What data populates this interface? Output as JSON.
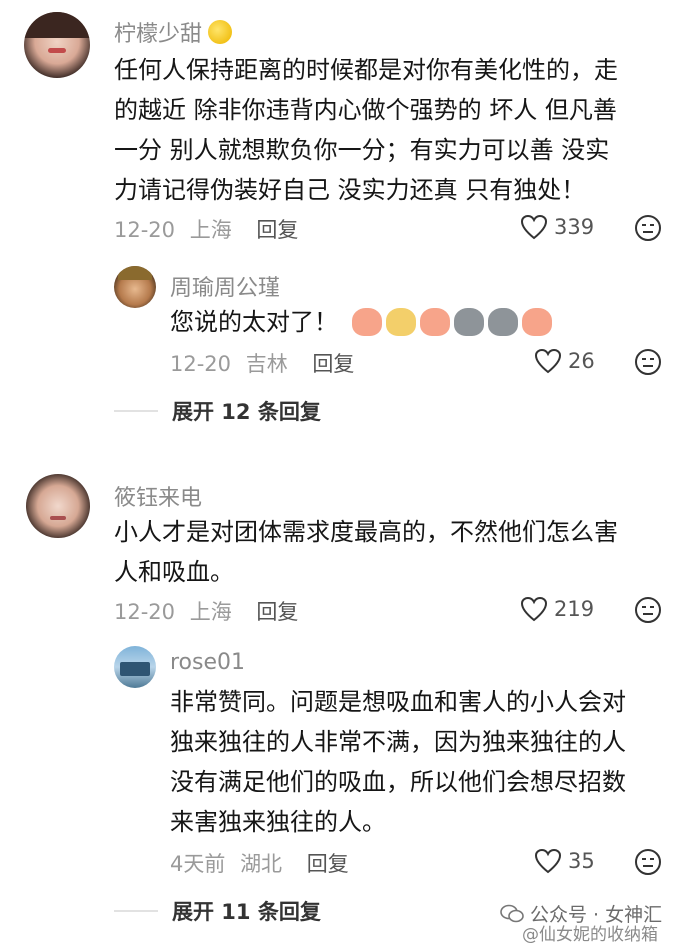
{
  "comments": [
    {
      "username": "柠檬少甜",
      "content": "任何人保持距离的时候都是对你有美化性的，走的越近 除非你违背内心做个强势的 坏人 但凡善一分 别人就想欺负你一分；有实力可以善 没实力请记得伪装好自己 没实力还真 只有独处！",
      "lines": [
        "任何人保持距离的时候都是对你有美化性的，走",
        "的越近 除非你违背内心做个强势的 坏人 但凡善",
        "一分 别人就想欺负你一分；有实力可以善 没实",
        "力请记得伪装好自己 没实力还真 只有独处！"
      ],
      "date": "12-20",
      "location": "上海",
      "reply_label": "回复",
      "likes": "339",
      "reply": {
        "username": "周瑜周公瑾",
        "content": "您说的太对了！",
        "date": "12-20",
        "location": "吉林",
        "reply_label": "回复",
        "likes": "26"
      },
      "expand_label": "展开 12 条回复"
    },
    {
      "username": "筱钰来电",
      "content": "小人才是对团体需求度最高的，不然他们怎么害人和吸血。",
      "lines": [
        "小人才是对团体需求度最高的，不然他们怎么害",
        "人和吸血。"
      ],
      "date": "12-20",
      "location": "上海",
      "reply_label": "回复",
      "likes": "219",
      "reply": {
        "username": "rose01",
        "content": "非常赞同。问题是想吸血和害人的小人会对独来独往的人非常不满，因为独来独往的人没有满足他们的吸血，所以他们会想尽招数来害独来独往的人。",
        "lines": [
          "非常赞同。问题是想吸血和害人的小人会对",
          "独来独往的人非常不满，因为独来独往的人",
          "没有满足他们的吸血，所以他们会想尽招数",
          "来害独来独往的人。"
        ],
        "date": "4天前",
        "location": "湖北",
        "reply_label": "回复",
        "likes": "35"
      },
      "expand_label": "展开 11 条回复"
    }
  ],
  "watermark": {
    "line1": "公众号 · 女神汇",
    "line2": "@仙女妮的收纳箱"
  },
  "colors": {
    "text": "#161616",
    "muted": "#9a9a9a",
    "lemon": "#f2c21a"
  },
  "icons": [
    "heart-outline-icon",
    "dislike-face-icon",
    "lemon-icon",
    "wechat-icon"
  ]
}
